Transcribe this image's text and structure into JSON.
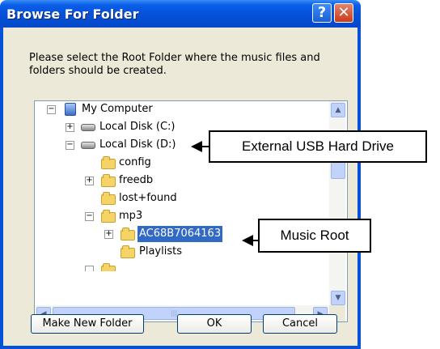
{
  "window": {
    "title": "Browse For Folder",
    "help_glyph": "?",
    "close_glyph": "✕"
  },
  "prompt": "Please select the Root Folder where the music files and folders should be created.",
  "tree": {
    "items": [
      {
        "label": "My Computer",
        "icon": "computer-icon",
        "expander": "−"
      },
      {
        "label": "Local Disk (C:)",
        "icon": "disk-icon",
        "expander": "+"
      },
      {
        "label": "Local Disk (D:)",
        "icon": "disk-icon",
        "expander": "−"
      },
      {
        "label": "config",
        "icon": "folder-icon"
      },
      {
        "label": "freedb",
        "icon": "folder-icon",
        "expander": "+"
      },
      {
        "label": "lost+found",
        "icon": "folder-icon"
      },
      {
        "label": "mp3",
        "icon": "folder-icon",
        "expander": "−"
      },
      {
        "label": "AC68B7064163",
        "icon": "folder-icon",
        "expander": "+",
        "selected": true
      },
      {
        "label": "Playlists",
        "icon": "folder-icon"
      }
    ],
    "scroll_up": "▲",
    "scroll_down": "▼",
    "scroll_left": "◀",
    "scroll_right": "▶",
    "hthumb_grip": "|||"
  },
  "buttons": {
    "make_new_folder": "Make New Folder",
    "ok": "OK",
    "cancel": "Cancel"
  },
  "callouts": {
    "usb": "External USB Hard Drive",
    "music_root": "Music Root"
  },
  "colors": {
    "titlebar": "#0551d8",
    "selection": "#316ac5",
    "dialog_face": "#ece9d8"
  }
}
